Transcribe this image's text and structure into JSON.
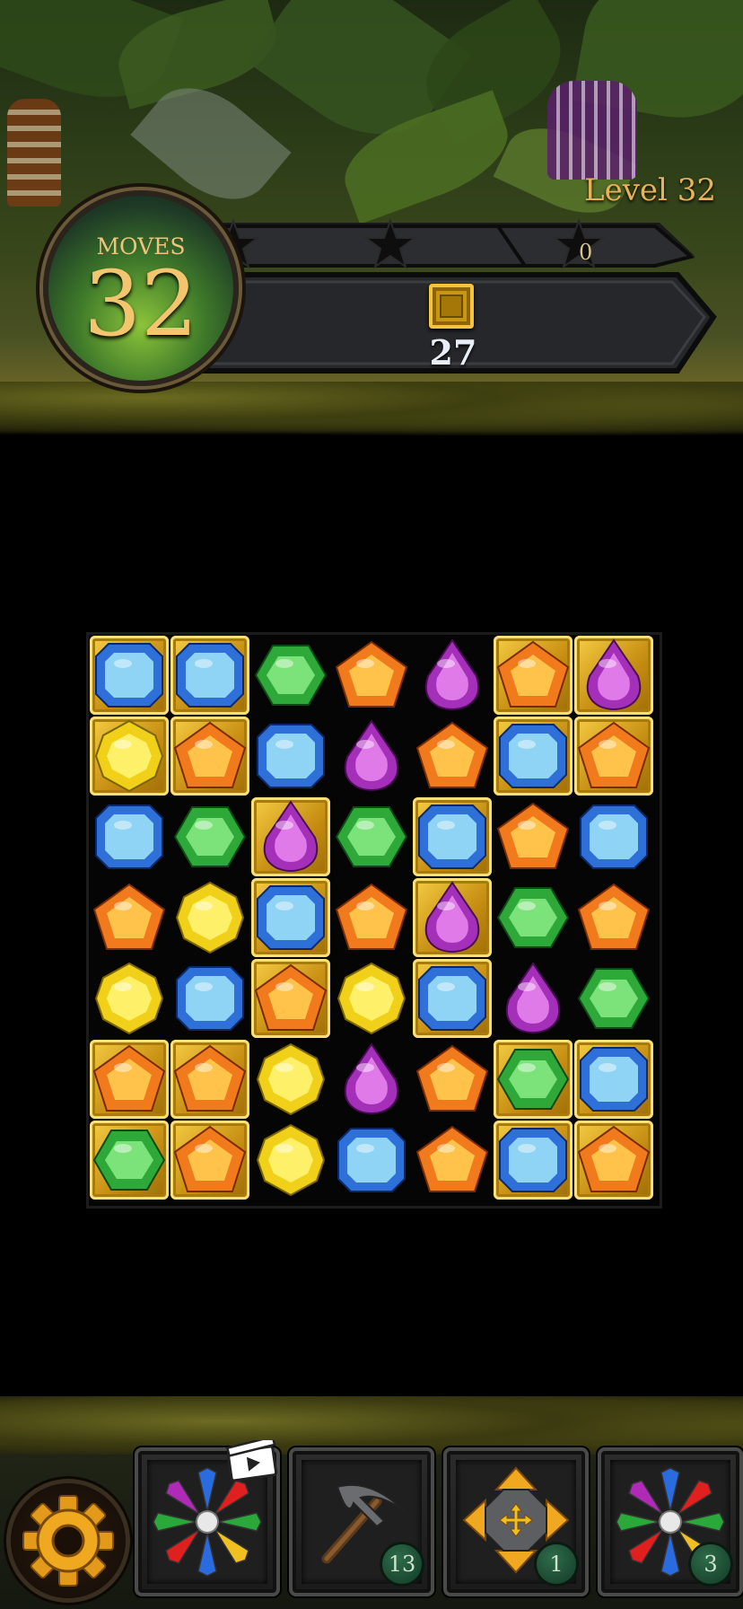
{
  "hud": {
    "level_label": "Level 32",
    "moves_label": "MOVES",
    "moves_value": "32",
    "score_value": "0",
    "stars_total": 3,
    "stars_earned": 0
  },
  "goal": {
    "icon": "gold-tile-icon",
    "remaining": "27"
  },
  "board": {
    "cols": 7,
    "rows": 7,
    "gem_colors": {
      "blue": "#2f6fd8",
      "green": "#2fa83a",
      "orange": "#f07a1c",
      "purple": "#a42fb8",
      "yellow": "#f0d018"
    },
    "tile_color": "#d9a21c",
    "cells": [
      [
        {
          "gem": "blue",
          "tile": true
        },
        {
          "gem": "blue",
          "tile": true
        },
        {
          "gem": "green",
          "tile": false
        },
        {
          "gem": "orange",
          "tile": false
        },
        {
          "gem": "purple",
          "tile": false
        },
        {
          "gem": "orange",
          "tile": true
        },
        {
          "gem": "purple",
          "tile": true
        }
      ],
      [
        {
          "gem": "yellow",
          "tile": true
        },
        {
          "gem": "orange",
          "tile": true
        },
        {
          "gem": "blue",
          "tile": false
        },
        {
          "gem": "purple",
          "tile": false
        },
        {
          "gem": "orange",
          "tile": false
        },
        {
          "gem": "blue",
          "tile": true
        },
        {
          "gem": "orange",
          "tile": true
        }
      ],
      [
        {
          "gem": "blue",
          "tile": false
        },
        {
          "gem": "green",
          "tile": false
        },
        {
          "gem": "purple",
          "tile": true
        },
        {
          "gem": "green",
          "tile": false
        },
        {
          "gem": "blue",
          "tile": true
        },
        {
          "gem": "orange",
          "tile": false
        },
        {
          "gem": "blue",
          "tile": false
        }
      ],
      [
        {
          "gem": "orange",
          "tile": false
        },
        {
          "gem": "yellow",
          "tile": false
        },
        {
          "gem": "blue",
          "tile": true
        },
        {
          "gem": "orange",
          "tile": false
        },
        {
          "gem": "purple",
          "tile": true
        },
        {
          "gem": "green",
          "tile": false
        },
        {
          "gem": "orange",
          "tile": false
        }
      ],
      [
        {
          "gem": "yellow",
          "tile": false
        },
        {
          "gem": "blue",
          "tile": false
        },
        {
          "gem": "orange",
          "tile": true
        },
        {
          "gem": "yellow",
          "tile": false
        },
        {
          "gem": "blue",
          "tile": true
        },
        {
          "gem": "purple",
          "tile": false
        },
        {
          "gem": "green",
          "tile": false
        }
      ],
      [
        {
          "gem": "orange",
          "tile": true
        },
        {
          "gem": "orange",
          "tile": true
        },
        {
          "gem": "yellow",
          "tile": false
        },
        {
          "gem": "purple",
          "tile": false
        },
        {
          "gem": "orange",
          "tile": false
        },
        {
          "gem": "green",
          "tile": true
        },
        {
          "gem": "blue",
          "tile": true
        }
      ],
      [
        {
          "gem": "green",
          "tile": true
        },
        {
          "gem": "orange",
          "tile": true
        },
        {
          "gem": "yellow",
          "tile": false
        },
        {
          "gem": "blue",
          "tile": false
        },
        {
          "gem": "orange",
          "tile": false
        },
        {
          "gem": "blue",
          "tile": true
        },
        {
          "gem": "orange",
          "tile": true
        }
      ]
    ]
  },
  "boosters": [
    {
      "id": "flower-bomb",
      "icon": "multicolor-flower-gem-icon",
      "count": "",
      "has_video": true
    },
    {
      "id": "pickaxe",
      "icon": "pickaxe-icon",
      "count": "13",
      "has_video": false
    },
    {
      "id": "shuffle",
      "icon": "move-arrows-icon",
      "count": "1",
      "has_video": false
    },
    {
      "id": "flower-bomb-2",
      "icon": "multicolor-flower-gem-icon",
      "count": "3",
      "has_video": false
    }
  ],
  "settings": {
    "icon": "gear-icon"
  }
}
